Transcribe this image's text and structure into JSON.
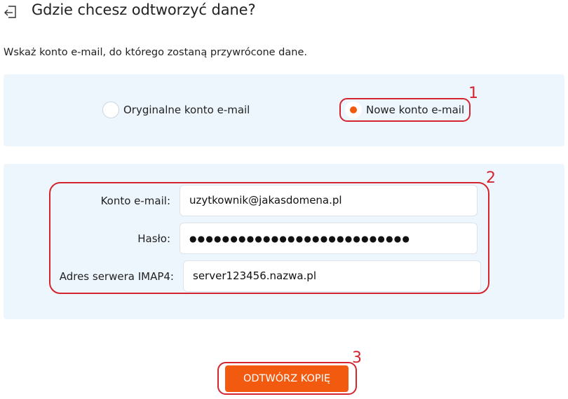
{
  "header": {
    "icon": "restore-arrow-icon",
    "title": "Gdzie chcesz odtworzyć dane?"
  },
  "instruction": "Wskaż konto e-mail, do którego zostaną przywrócone dane.",
  "destination_options": [
    {
      "label": "Oryginalne konto e-mail",
      "selected": false
    },
    {
      "label": "Nowe konto e-mail",
      "selected": true
    }
  ],
  "form": {
    "email": {
      "label": "Konto e-mail:",
      "value": "uzytkownik@jakasdomena.pl"
    },
    "password": {
      "label": "Hasło:",
      "value": "●●●●●●●●●●●●●●●●●●●●●●●●●●●"
    },
    "server": {
      "label": "Adres serwera IMAP4:",
      "value": "server123456.nazwa.pl"
    }
  },
  "restore_button": {
    "label": "ODTWÓRZ KOPIĘ"
  },
  "annotations": [
    "1",
    "2",
    "3"
  ],
  "colors": {
    "accent": "#f25a0f",
    "panel_background": "#eef6fd",
    "annotation": "#d4242f"
  }
}
